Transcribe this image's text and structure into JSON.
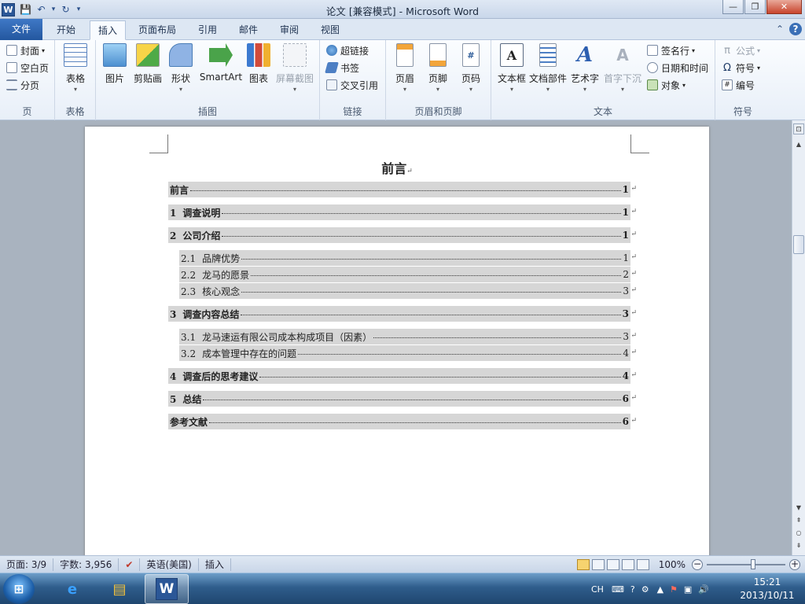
{
  "window": {
    "title": "论文 [兼容模式] - Microsoft Word",
    "app_icon_letter": "W",
    "controls": {
      "minimize": "—",
      "maximize": "❐",
      "close": "✕"
    }
  },
  "qat": {
    "save_icon": "💾",
    "undo_icon": "↶",
    "undo_drop": "▾",
    "redo_icon": "↻",
    "customize": "▾"
  },
  "tabs": [
    {
      "label": "文件"
    },
    {
      "label": "开始"
    },
    {
      "label": "插入"
    },
    {
      "label": "页面布局"
    },
    {
      "label": "引用"
    },
    {
      "label": "邮件"
    },
    {
      "label": "审阅"
    },
    {
      "label": "视图"
    }
  ],
  "ribbon": {
    "pages": {
      "cover": "封面",
      "blank": "空白页",
      "break": "分页",
      "label": "页"
    },
    "tables": {
      "table": "表格",
      "label": "表格"
    },
    "illustrations": {
      "picture": "图片",
      "clipart": "剪贴画",
      "shapes": "形状",
      "smartart": "SmartArt",
      "chart": "图表",
      "screenshot": "屏幕截图",
      "label": "插图"
    },
    "links": {
      "hyperlink": "超链接",
      "bookmark": "书签",
      "crossref": "交叉引用",
      "label": "链接"
    },
    "headerfooter": {
      "header": "页眉",
      "footer": "页脚",
      "pagenum": "页码",
      "label": "页眉和页脚"
    },
    "text": {
      "textbox": "文本框",
      "quickparts": "文档部件",
      "wordart": "艺术字",
      "dropcap": "首字下沉",
      "signature": "签名行",
      "datetime": "日期和时间",
      "object": "对象",
      "label": "文本"
    },
    "symbols": {
      "equation": "公式",
      "symbol": "符号",
      "number": "编号",
      "label": "符号"
    }
  },
  "document": {
    "title": "前言",
    "para_mark": "↵",
    "toc": [
      {
        "num": "",
        "text": "前言",
        "page": "1",
        "level": 1
      },
      {
        "num": "1",
        "text": "调查说明",
        "page": "1",
        "level": 1
      },
      {
        "num": "2",
        "text": "公司介绍",
        "page": "1",
        "level": 1
      },
      {
        "num": "2.1",
        "text": "品牌优势",
        "page": "1",
        "level": 2
      },
      {
        "num": "2.2",
        "text": "龙马的愿景",
        "page": "2",
        "level": 2
      },
      {
        "num": "2.3",
        "text": "核心观念",
        "page": "3",
        "level": 2
      },
      {
        "num": "3",
        "text": "调查内容总结",
        "page": "3",
        "level": 1
      },
      {
        "num": "3.1",
        "text": "龙马速运有限公司成本构成项目（因素）",
        "page": "3",
        "level": 2
      },
      {
        "num": "3.2",
        "text": "成本管理中存在的问题",
        "page": "4",
        "level": 2
      },
      {
        "num": "4",
        "text": "调查后的思考建议",
        "page": "4",
        "level": 1
      },
      {
        "num": "5",
        "text": "总结",
        "page": "6",
        "level": 1
      },
      {
        "num": "",
        "text": "参考文献",
        "page": "6",
        "level": 1
      }
    ]
  },
  "statusbar": {
    "page": "页面: 3/9",
    "words": "字数: 3,956",
    "language": "英语(美国)",
    "mode": "插入",
    "zoom": "100%",
    "zoom_minus": "−",
    "zoom_plus": "+"
  },
  "taskbar": {
    "start": "⊞",
    "tray_lang": "CH",
    "time": "15:21",
    "date": "2013/10/11"
  },
  "colors": {
    "accent": "#2b5797",
    "toc_shading": "#d6d6d6"
  }
}
